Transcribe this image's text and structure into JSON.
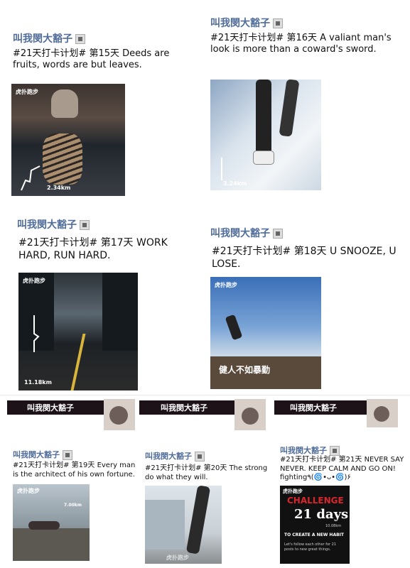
{
  "posts": [
    {
      "user": "叫我閔大豁子",
      "text": "#21天打卡计划# 第15天  Deeds are fruits, words are but leaves.",
      "watermark": "虎扑跑步",
      "distance": "2.34km"
    },
    {
      "user": "叫我閔大豁子",
      "text": "#21天打卡计划# 第16天  A valiant man's look is more than a coward's sword.",
      "distance": "3.24km"
    },
    {
      "user": "叫我閔大豁子",
      "text": "#21天打卡计划# 第17天  WORK HARD, RUN HARD.",
      "watermark": "虎扑跑步",
      "distance": "11.18km"
    },
    {
      "user": "叫我閔大豁子",
      "text": "#21天打卡计划# 第18天  U SNOOZE, U LOSE.",
      "watermark": "虎扑跑步",
      "overlay": "健人不如暴勤"
    },
    {
      "user": "叫我閔大豁子",
      "text": "#21天打卡计划# 第19天  Every man is the architect of his own fortune.",
      "watermark": "虎扑跑步",
      "distance": "7.00km"
    },
    {
      "user": "叫我閔大豁子",
      "text": "#21天打卡计划# 第20天  The strong do what they will.",
      "watermark": "虎扑跑步"
    },
    {
      "user": "叫我閔大豁子",
      "text": "#21天打卡计划# 第21天 NEVER SAY NEVER.        KEEP CALM AND GO ON!              fighting٩(🌀•ᴗ•🌀)۶",
      "watermark": "虎扑跑步",
      "challenge": {
        "title": "CHALLENGE",
        "days": "21 days",
        "distance": "10.08km",
        "subtitle": "TO CREATE A NEW HABIT",
        "footer": "Let's follow each other for 21 posts to new great things."
      }
    }
  ],
  "banners": [
    {
      "user": "叫我閔大豁子"
    },
    {
      "user": "叫我閔大豁子"
    },
    {
      "user": "叫我閔大豁子"
    }
  ],
  "colors": {
    "username": "#4f6c9a",
    "banner_bg": "#1c1218",
    "challenge_red": "#d8262c"
  }
}
